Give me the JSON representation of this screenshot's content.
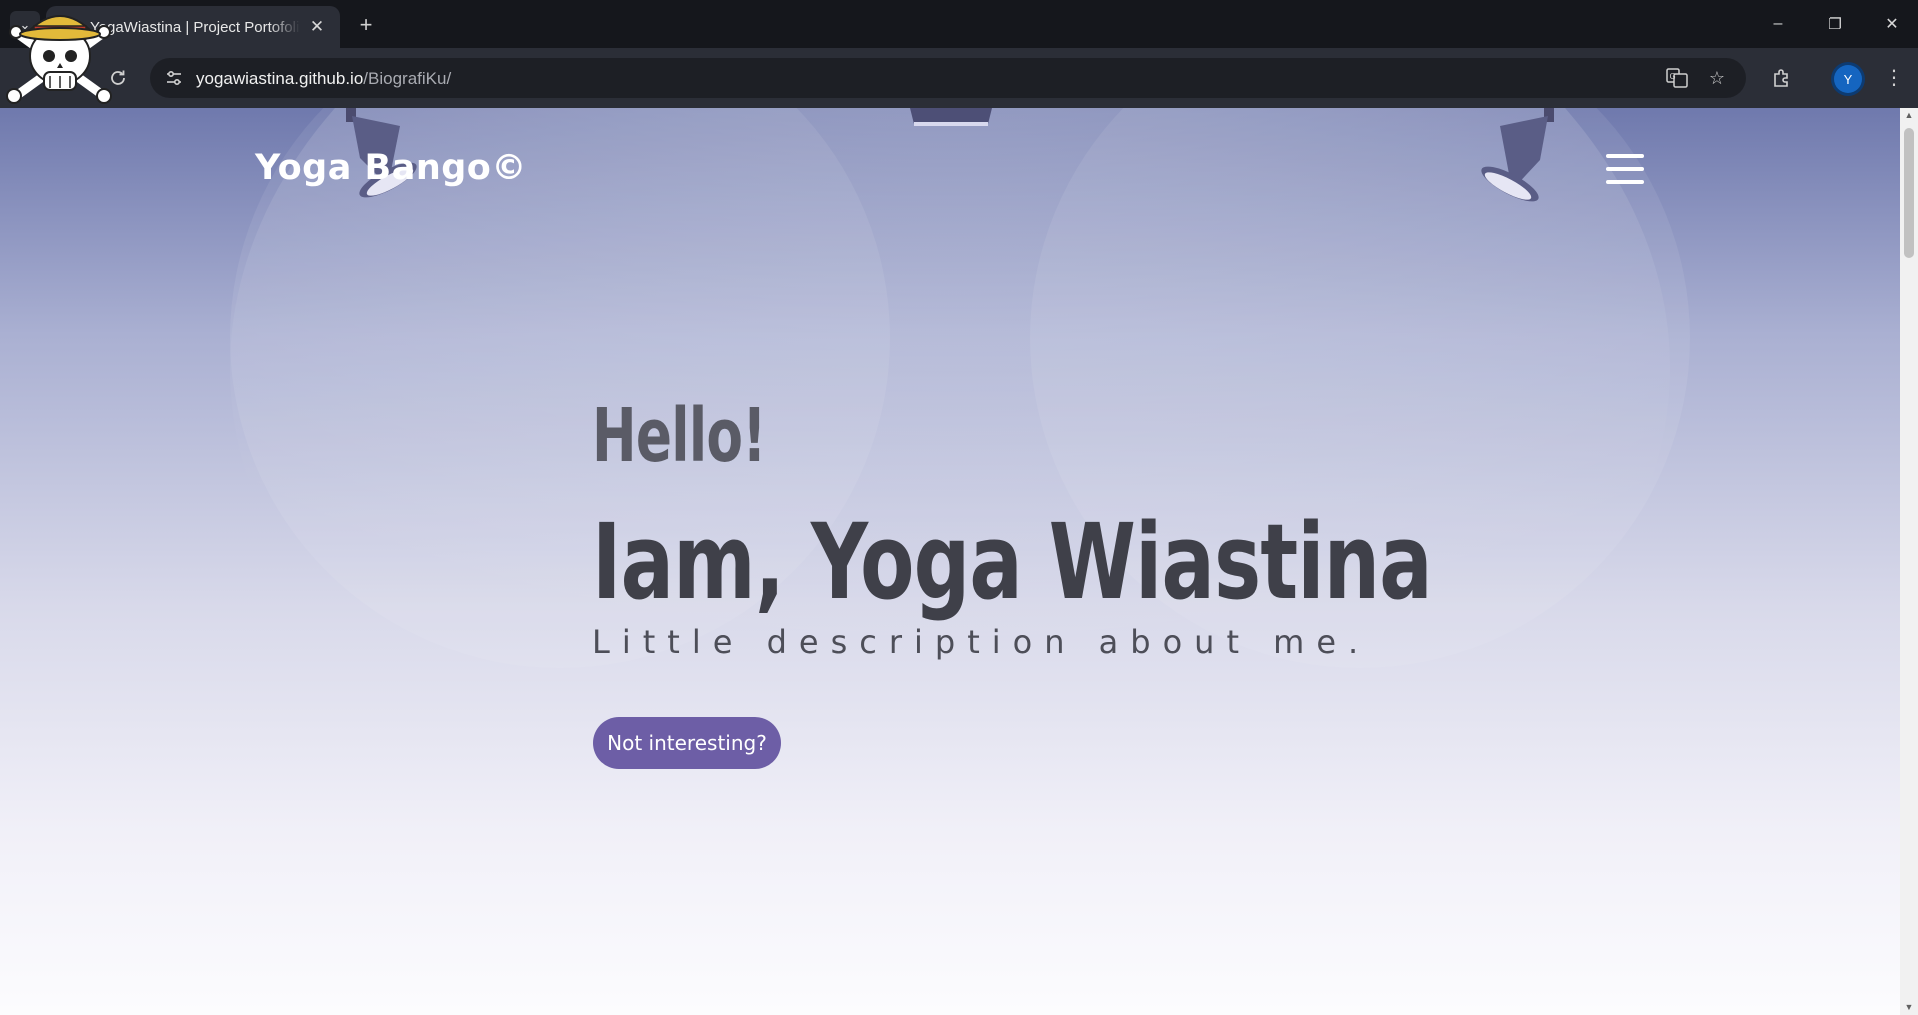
{
  "browser": {
    "tab_title": "YogaWiastina | Project Portofolio",
    "tab_close": "✕",
    "new_tab": "+",
    "tab_menu": "⌄",
    "url_host": "yogawiastina.github.io",
    "url_path": "/BiografiKu/",
    "profile_initial": "Y",
    "controls": {
      "minimize": "–",
      "restore": "❐",
      "close": "✕"
    },
    "icons": [
      "tab-search-icon",
      "reload-icon",
      "site-info-icon",
      "translate-icon",
      "bookmark-star-icon",
      "extensions-icon",
      "more-menu-icon",
      "jolly-roger-icon"
    ]
  },
  "page": {
    "brand": "Yoga Bango©",
    "hello": "Hello!",
    "name": "Iam, Yoga Wiastina",
    "description": "Little description about me.",
    "cta_label": "Not interesting?",
    "colors": {
      "cta_background": "#6d5ea6",
      "heading": "#3f4049",
      "background_top": "#6f79ad",
      "background_bottom": "#fcfcfe"
    }
  }
}
